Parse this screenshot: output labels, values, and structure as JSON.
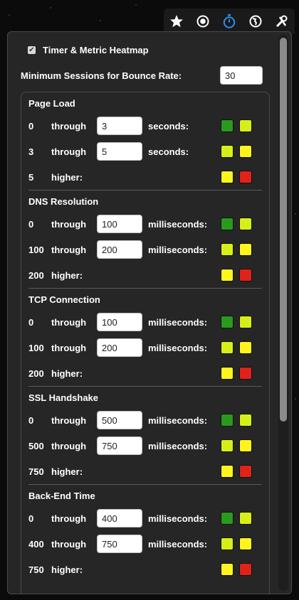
{
  "toolbar": {
    "icons": [
      "star-icon",
      "record-icon",
      "stopwatch-icon",
      "globe-icon",
      "tools-icon"
    ]
  },
  "heatmap": {
    "checked": true,
    "label": "Timer & Metric Heatmap"
  },
  "min_sessions": {
    "label": "Minimum Sessions for Bounce Rate:",
    "value": "30"
  },
  "colors": {
    "green": "#2a9a1e",
    "yellow_green": "#d7ef18",
    "yellow": "#fff51e",
    "red": "#e0231a"
  },
  "sections": [
    {
      "title": "Page Load",
      "rows": [
        {
          "from": "0",
          "through": "through",
          "value": "3",
          "unit": "seconds:",
          "c1": "#2a9a1e",
          "c2": "#d7ef18"
        },
        {
          "from": "3",
          "through": "through",
          "value": "5",
          "unit": "seconds:",
          "c1": "#d7ef18",
          "c2": "#fff51e"
        },
        {
          "from": "5",
          "through": "higher:",
          "value": "",
          "unit": "",
          "c1": "#fff51e",
          "c2": "#e0231a"
        }
      ]
    },
    {
      "title": "DNS Resolution",
      "rows": [
        {
          "from": "0",
          "through": "through",
          "value": "100",
          "unit": "milliseconds:",
          "c1": "#2a9a1e",
          "c2": "#d7ef18"
        },
        {
          "from": "100",
          "through": "through",
          "value": "200",
          "unit": "milliseconds:",
          "c1": "#d7ef18",
          "c2": "#fff51e"
        },
        {
          "from": "200",
          "through": "higher:",
          "value": "",
          "unit": "",
          "c1": "#fff51e",
          "c2": "#e0231a"
        }
      ]
    },
    {
      "title": "TCP Connection",
      "rows": [
        {
          "from": "0",
          "through": "through",
          "value": "100",
          "unit": "milliseconds:",
          "c1": "#2a9a1e",
          "c2": "#d7ef18"
        },
        {
          "from": "100",
          "through": "through",
          "value": "200",
          "unit": "milliseconds:",
          "c1": "#d7ef18",
          "c2": "#fff51e"
        },
        {
          "from": "200",
          "through": "higher:",
          "value": "",
          "unit": "",
          "c1": "#fff51e",
          "c2": "#e0231a"
        }
      ]
    },
    {
      "title": "SSL Handshake",
      "rows": [
        {
          "from": "0",
          "through": "through",
          "value": "500",
          "unit": "milliseconds:",
          "c1": "#2a9a1e",
          "c2": "#d7ef18"
        },
        {
          "from": "500",
          "through": "through",
          "value": "750",
          "unit": "milliseconds:",
          "c1": "#d7ef18",
          "c2": "#fff51e"
        },
        {
          "from": "750",
          "through": "higher:",
          "value": "",
          "unit": "",
          "c1": "#fff51e",
          "c2": "#e0231a"
        }
      ]
    },
    {
      "title": "Back-End Time",
      "rows": [
        {
          "from": "0",
          "through": "through",
          "value": "400",
          "unit": "milliseconds:",
          "c1": "#2a9a1e",
          "c2": "#d7ef18"
        },
        {
          "from": "400",
          "through": "through",
          "value": "750",
          "unit": "milliseconds:",
          "c1": "#d7ef18",
          "c2": "#fff51e"
        },
        {
          "from": "750",
          "through": "higher:",
          "value": "",
          "unit": "",
          "c1": "#fff51e",
          "c2": "#e0231a"
        }
      ]
    }
  ]
}
